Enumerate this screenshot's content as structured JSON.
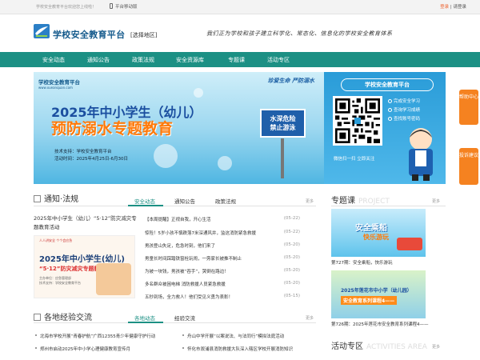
{
  "topbar": {
    "welcome": "学校安全教育平台欢迎您上线啦！",
    "mobile": "平台移动版",
    "login": "登录",
    "sep": "|",
    "register": "请登录"
  },
  "header": {
    "logo": "学校安全教育平台",
    "region": "[选择地区]",
    "slogan": "我们正为学校和孩子建立科学化、常态化、信息化的学校安全教育体系"
  },
  "nav": [
    "安全动态",
    "通知公告",
    "政策法规",
    "安全资源库",
    "专题课",
    "活动专区"
  ],
  "banner": {
    "logo": "学校安全教育平台",
    "logo_url": "www.xueanquan.com",
    "slogan": "珍爱生命  严防溺水",
    "title1": "2025年中小学生（幼儿）",
    "title2": "预防溺水专题教育",
    "support": "技术支持：学校安全教育平台",
    "time": "活动时间：2025年4月25日-6月30日",
    "sign1": "水深危险",
    "sign2": "禁止游泳"
  },
  "panel": {
    "title": "学校安全教育平台",
    "checks": [
      "完成安全学习",
      "查询学习成绩",
      "查找账号密码"
    ],
    "scan": "微信扫一扫  立即关注"
  },
  "float": {
    "help": "帮助中心",
    "feedback": "投诉建议"
  },
  "notice": {
    "title": "通知",
    "title2": "法规",
    "tabs": [
      "安全动态",
      "通知公告",
      "政策法规"
    ],
    "more": "更多",
    "headline": "2025年中小学生（幼儿）“5·12”防灾减灾专题教育活动",
    "poster_top": "人人讲安全  个个会应急",
    "poster_t1": "2025年中小学生(幼儿)",
    "poster_t2": "“5·12”防灾减灾专题教育",
    "poster_t3": "主办单位：应急管理部\n技术支持：学校安全教育平台",
    "items": [
      {
        "text": "【本周提醒】正视自我，开心生活",
        "date": "(05-22)"
      },
      {
        "text": "惊险！5岁小孩不慎跌落7米深通风井，监这消防紧急救援",
        "date": "(05-22)"
      },
      {
        "text": "男孩登山失足，危急时刻，他们来了",
        "date": "(05-20)"
      },
      {
        "text": "男童长时间踩踏铁窗栓玩闹，一旁家长被推不制止",
        "date": "(05-20)"
      },
      {
        "text": "为被一块钱，男孩被“吞手”，哭倒在路边！",
        "date": "(05-20)"
      },
      {
        "text": "多名群众被困电梯 消防救援人员紧急救援",
        "date": "(05-20)"
      },
      {
        "text": "五秒到场，全力救人！他们受见义勇为表彰！",
        "date": "(05-15)"
      }
    ]
  },
  "exchange": {
    "title": "各地经验交流",
    "tabs": [
      "各地动态",
      "经验交流"
    ],
    "more": "更多",
    "items": [
      "北海市学校开展“青春护航”广西12355青少年健康守护行动",
      "郑州市启动2025年中小学心理健康教育宣传月",
      "舟山中学开展“以案说法、与法同行”模拟法庭活动",
      "怀化市溆浦县消防救援大队深入辖区学校开展消防知识"
    ]
  },
  "topic": {
    "title": "专题课",
    "en": "PROJECT",
    "more": "更多",
    "card1_title": "安全乘船",
    "card1_sub": "快乐游玩",
    "cap1": "第727期：安全乘船，快乐游玩",
    "card2_title": "2025年莲花市中小学（幼儿园）",
    "card2_sub": "安全教育系列课程4——",
    "cap2": "第726期：2025年莲花市安全教育系列课程4——"
  },
  "activity": {
    "title": "活动专区",
    "en": "ACTIVITIES AREA"
  }
}
